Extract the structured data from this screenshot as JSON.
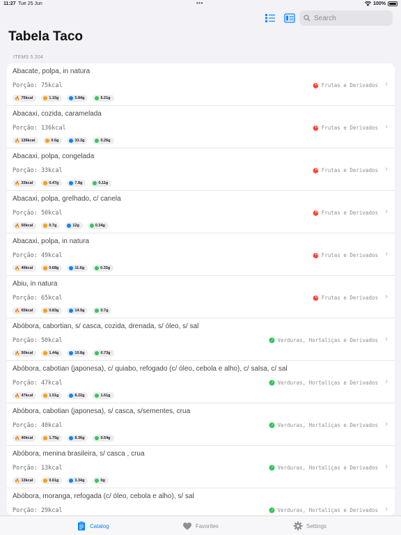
{
  "status": {
    "time": "11:27",
    "date": "Tue 25 Jun",
    "dots": "•••",
    "battery": "100%"
  },
  "search": {
    "placeholder": "Search"
  },
  "page_title": "Tabela Taco",
  "items_count": "ITEMS 5.204",
  "colors": {
    "accent": "#0a84ff",
    "calories": "#ff3b30",
    "protein": "#ff9f0a",
    "carbs": "#0a84ff",
    "fat": "#34c759",
    "fruit": "#ff453a",
    "veg": "#34c759"
  },
  "items": [
    {
      "name": "Abacate, polpa, in natura",
      "porcao": "Porção: 75kcal",
      "category": "Frutas e Derivados",
      "cat_icon": "apple-icon",
      "kcal": "75kcal",
      "p": "1.15g",
      "c": "5.84g",
      "f": "6.21g"
    },
    {
      "name": "Abacaxi, cozida, caramelada",
      "porcao": "Porção: 136kcal",
      "category": "Frutas e Derivados",
      "cat_icon": "apple-icon",
      "kcal": "136kcal",
      "p": "0.6g",
      "c": "33.3g",
      "f": "0.26g"
    },
    {
      "name": "Abacaxi, polpa, congelada",
      "porcao": "Porção: 33kcal",
      "category": "Frutas e Derivados",
      "cat_icon": "apple-icon",
      "kcal": "33kcal",
      "p": "0.47g",
      "c": "7.8g",
      "f": "0.11g"
    },
    {
      "name": "Abacaxi, polpa, grelhado, c/ canela",
      "porcao": "Porção: 50kcal",
      "category": "Frutas e Derivados",
      "cat_icon": "apple-icon",
      "kcal": "50kcal",
      "p": "0.7g",
      "c": "12g",
      "f": "0.34g"
    },
    {
      "name": "Abacaxi, polpa, in natura",
      "porcao": "Porção: 49kcal",
      "category": "Frutas e Derivados",
      "cat_icon": "apple-icon",
      "kcal": "49kcal",
      "p": "0.68g",
      "c": "11.6g",
      "f": "0.33g"
    },
    {
      "name": "Abiu, in natura",
      "porcao": "Porção: 65kcal",
      "category": "Frutas e Derivados",
      "cat_icon": "apple-icon",
      "kcal": "65kcal",
      "p": "0.83g",
      "c": "14.9g",
      "f": "0.7g"
    },
    {
      "name": "Abóbora, cabortian, s/ casca, cozida, drenada, s/ óleo, s/ sal",
      "porcao": "Porção: 50kcal",
      "category": "Verduras, Hortaliças e Derivados",
      "cat_icon": "lettuce-icon",
      "kcal": "50kcal",
      "p": "1.44g",
      "c": "10.8g",
      "f": "0.73g"
    },
    {
      "name": "Abóbora, cabotian (japonesa), c/ quiabo, refogado (c/ óleo, cebola e alho), c/ salsa, c/ sal",
      "porcao": "Porção: 47kcal",
      "category": "Verduras, Hortaliças e Derivados",
      "cat_icon": "lettuce-icon",
      "kcal": "47kcal",
      "p": "1.51g",
      "c": "8.22g",
      "f": "1.61g"
    },
    {
      "name": "Abóbora, cabotian (japonesa), s/ casca, s/sementes, crua",
      "porcao": "Porção: 40kcal",
      "category": "Verduras, Hortaliças e Derivados",
      "cat_icon": "lettuce-icon",
      "kcal": "40kcal",
      "p": "1.75g",
      "c": "8.36g",
      "f": "0.54g"
    },
    {
      "name": "Abóbora, menina brasileira, s/ casca , crua",
      "porcao": "Porção: 13kcal",
      "category": "Verduras, Hortaliças e Derivados",
      "cat_icon": "lettuce-icon",
      "kcal": "13kcal",
      "p": "0.61g",
      "c": "3.34g",
      "f": "0g"
    },
    {
      "name": "Abóbora, moranga, refogada (c/ óleo, cebola e alho), s/ sal",
      "porcao": "Porção: 29kcal",
      "category": "Verduras, Hortaliças e Derivados",
      "cat_icon": "lettuce-icon",
      "kcal": "",
      "p": "",
      "c": "",
      "f": ""
    }
  ],
  "tabs": [
    {
      "label": "Catalog",
      "icon": "clipboard-icon",
      "active": true
    },
    {
      "label": "Favorites",
      "icon": "heart-icon",
      "active": false
    },
    {
      "label": "Settings",
      "icon": "gear-icon",
      "active": false
    }
  ]
}
